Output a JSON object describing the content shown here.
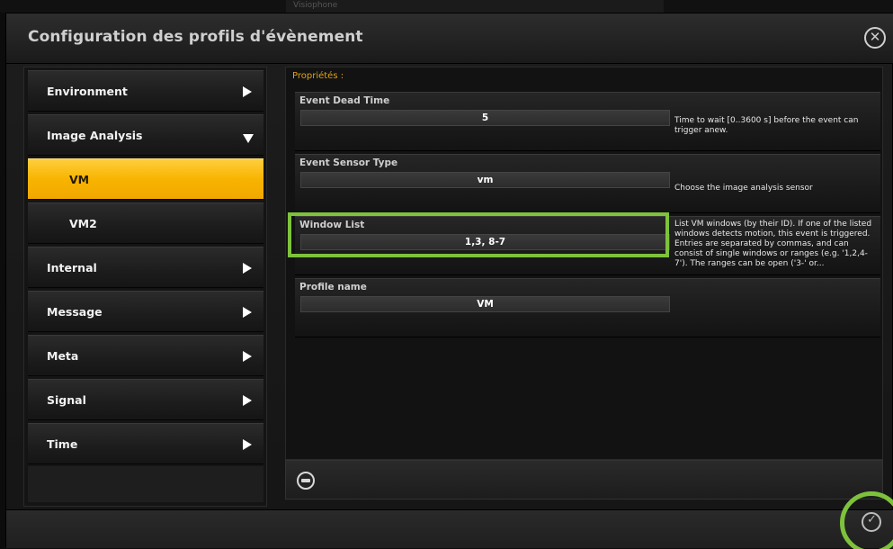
{
  "background": {
    "peek_label": "Visiophone"
  },
  "dialog": {
    "title": "Configuration des profils d'évènement",
    "close_icon": "close-icon",
    "highlight_color": "#7ec23c",
    "accent_color": "#f8b400"
  },
  "menu": {
    "items": [
      {
        "label": "Environment",
        "arrow": "right"
      },
      {
        "label": "Image Analysis",
        "arrow": "down"
      },
      {
        "label": "VM",
        "selected": true
      },
      {
        "label": "VM2"
      },
      {
        "label": "Internal",
        "arrow": "right"
      },
      {
        "label": "Message",
        "arrow": "right"
      },
      {
        "label": "Meta",
        "arrow": "right"
      },
      {
        "label": "Signal",
        "arrow": "right"
      },
      {
        "label": "Time",
        "arrow": "right"
      }
    ]
  },
  "properties": {
    "heading": "Propriétés :",
    "rows": [
      {
        "name": "Event Dead Time",
        "value": "5",
        "description": "Time to wait [0..3600 s] before the event can trigger anew."
      },
      {
        "name": "Event Sensor Type",
        "value": "vm",
        "description": "Choose the image analysis sensor"
      },
      {
        "name": "Window List",
        "value": "1,3, 8-7",
        "description": "List VM windows (by their ID). If one of the listed windows detects motion, this event is triggered. Entries are separated by commas, and can consist of single windows or ranges (e.g. '1,2,4-7'). The ranges can be open ('3-' or..."
      },
      {
        "name": "Profile name",
        "value": "VM",
        "description": ""
      }
    ]
  },
  "footer": {
    "remove_icon": "remove-icon",
    "confirm_icon": "check-icon"
  }
}
